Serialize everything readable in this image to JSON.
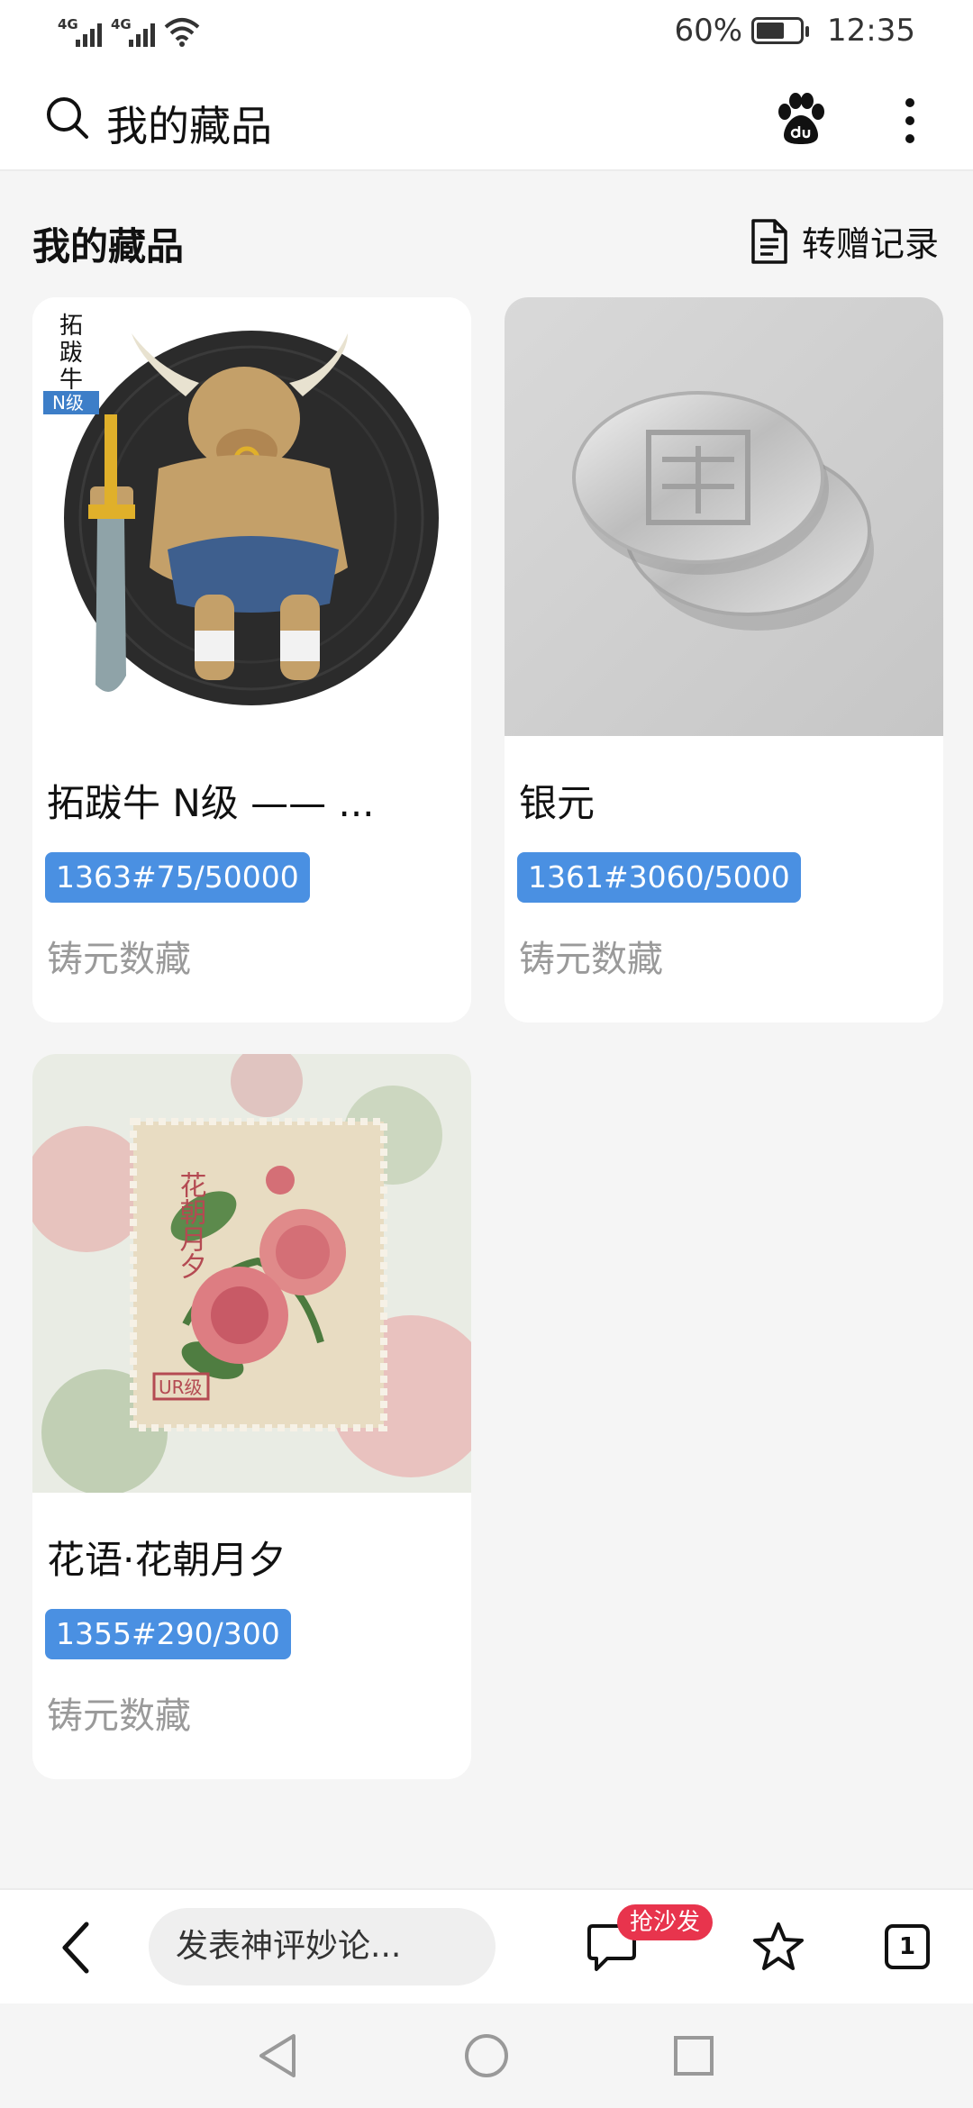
{
  "status_bar": {
    "signal_1": "4G",
    "signal_2": "4G",
    "battery": "60%",
    "time": "12:35"
  },
  "top_bar": {
    "title": "我的藏品"
  },
  "section": {
    "title": "我的藏品",
    "transfer_label": "转赠记录"
  },
  "items": [
    {
      "title": "拓跋牛 N级 —— ...",
      "serial": "1363#75/50000",
      "issuer": "铸元数藏",
      "art_lettering": [
        "拓",
        "跋",
        "牛",
        "N级"
      ]
    },
    {
      "title": "银元",
      "serial": "1361#3060/5000",
      "issuer": "铸元数藏"
    },
    {
      "title": "花语·花朝月夕",
      "serial": "1355#290/300",
      "issuer": "铸元数藏",
      "art_lettering": [
        "花朝月夕",
        "UR级"
      ]
    }
  ],
  "bottom_bar": {
    "comment_placeholder": "发表神评妙论...",
    "sofa_badge": "抢沙发",
    "tab_count": "1"
  },
  "colors": {
    "badge_blue": "#4a90e2",
    "sofa_red": "#e8344d",
    "issuer_gray": "#9a9a9a"
  }
}
